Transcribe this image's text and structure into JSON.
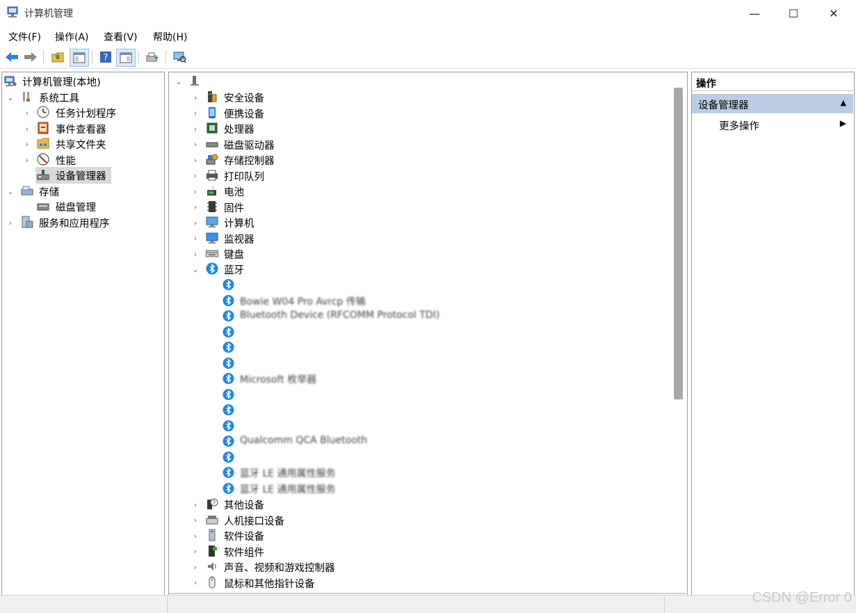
{
  "window": {
    "title": "计算机管理",
    "minimize_glyph": "—",
    "maximize_glyph": "☐",
    "close_glyph": "✕"
  },
  "menu": [
    "文件(F)",
    "操作(A)",
    "查看(V)",
    "帮助(H)"
  ],
  "toolbar": {
    "buttons": [
      "back-icon",
      "forward-icon",
      "up-folder-icon",
      "show-hide-tree-icon",
      "help-icon",
      "properties-icon",
      "export-icon",
      "scan-hardware-icon"
    ]
  },
  "left_tree": {
    "root": "计算机管理(本地)",
    "system_tools": "系统工具",
    "task_scheduler": "任务计划程序",
    "event_viewer": "事件查看器",
    "shared_folders": "共享文件夹",
    "performance": "性能",
    "device_manager": "设备管理器",
    "storage": "存储",
    "disk_management": "磁盘管理",
    "services_apps": "服务和应用程序"
  },
  "device_tree": {
    "computer_name": "",
    "categories_top": [
      "安全设备",
      "便携设备",
      "处理器",
      "磁盘驱动器",
      "存储控制器",
      "打印队列",
      "电池",
      "固件",
      "计算机",
      "监视器",
      "键盘"
    ],
    "bluetooth": "蓝牙",
    "bluetooth_children": [
      "",
      "Bowie W04 Pro Avrcp 传输",
      "Bluetooth Device (RFCOMM Protocol TDI)",
      "",
      "",
      "",
      "Microsoft 枚举器",
      "",
      "",
      "",
      "Qualcomm QCA Bluetooth",
      "",
      "蓝牙 LE 通用属性服务",
      "蓝牙 LE 通用属性服务"
    ],
    "categories_bottom": [
      "其他设备",
      "人机接口设备",
      "软件设备",
      "软件组件",
      "声音、视频和游戏控制器",
      "鼠标和其他指针设备"
    ]
  },
  "actions": {
    "header": "操作",
    "section": "设备管理器",
    "more": "更多操作"
  },
  "watermark": "CSDN @Error 0"
}
